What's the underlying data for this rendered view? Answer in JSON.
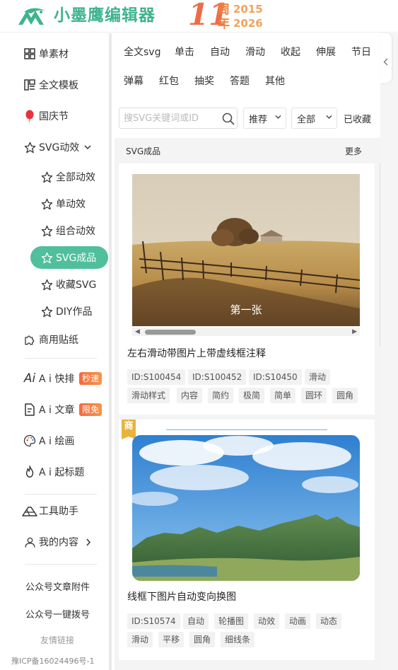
{
  "brand": {
    "name": "小墨鹰编辑器",
    "logo_icon": "eagle-logo-icon",
    "color": "#3fb38f"
  },
  "anniversary": {
    "number": "11",
    "zhou": "周",
    "nian": "年",
    "year_start": "2015",
    "year_end": "2026"
  },
  "sidebar": {
    "items": [
      {
        "label": "单素材",
        "icon": "grid-icon"
      },
      {
        "label": "全文模板",
        "icon": "template-icon"
      },
      {
        "label": "国庆节",
        "icon": "balloon-icon"
      },
      {
        "label": "SVG动效",
        "icon": "star-icon",
        "expanded": true
      }
    ],
    "svg_sub": [
      {
        "label": "全部动效"
      },
      {
        "label": "单动效"
      },
      {
        "label": "组合动效"
      },
      {
        "label": "SVG成品",
        "active": true
      },
      {
        "label": "收藏SVG"
      },
      {
        "label": "DIY作品"
      }
    ],
    "commercial": {
      "label": "商用贴纸",
      "icon": "puzzle-icon"
    },
    "ai": [
      {
        "label": "A i 快排",
        "icon": "ai-icon",
        "badge": "秒速"
      },
      {
        "label": "A i 文章",
        "icon": "document-icon",
        "badge": "限免"
      },
      {
        "label": "A i 绘画",
        "icon": "palette-icon"
      },
      {
        "label": "A i 起标题",
        "icon": "fire-icon"
      }
    ],
    "tools": {
      "label": "工具助手",
      "icon": "tools-icon"
    },
    "mine": {
      "label": "我的内容",
      "icon": "user-icon"
    },
    "links": [
      "公众号文章附件",
      "公众号一键拨号"
    ],
    "friend_links": "友情链接",
    "icp": "豫ICP备16024496号-1"
  },
  "filters": {
    "row1": [
      "全文svg",
      "单击",
      "自动",
      "滑动",
      "收起",
      "伸展",
      "节日"
    ],
    "row2": [
      "弹幕",
      "红包",
      "抽奖",
      "答题",
      "其他"
    ]
  },
  "search": {
    "placeholder": "搜SVG关键词或ID"
  },
  "sort": {
    "value": "推荐"
  },
  "scope": {
    "value": "全部"
  },
  "favorites_label": "已收藏",
  "section": {
    "title": "SVG成品",
    "more": "更多"
  },
  "cards": [
    {
      "caption": "第一张",
      "title": "左右滑动带图片上带虚线框注释",
      "tags": [
        "ID:S100454",
        "ID:S100452",
        "ID:S10450",
        "滑动",
        "滑动样式",
        "内容",
        "简约",
        "极简",
        "简单",
        "圆环",
        "圆角"
      ]
    },
    {
      "badge": "商",
      "title": "线框下图片自动变向换图",
      "tags": [
        "ID:S10574",
        "自动",
        "轮播图",
        "动效",
        "动画",
        "动态",
        "滑动",
        "平移",
        "圆角",
        "细线条"
      ]
    }
  ]
}
